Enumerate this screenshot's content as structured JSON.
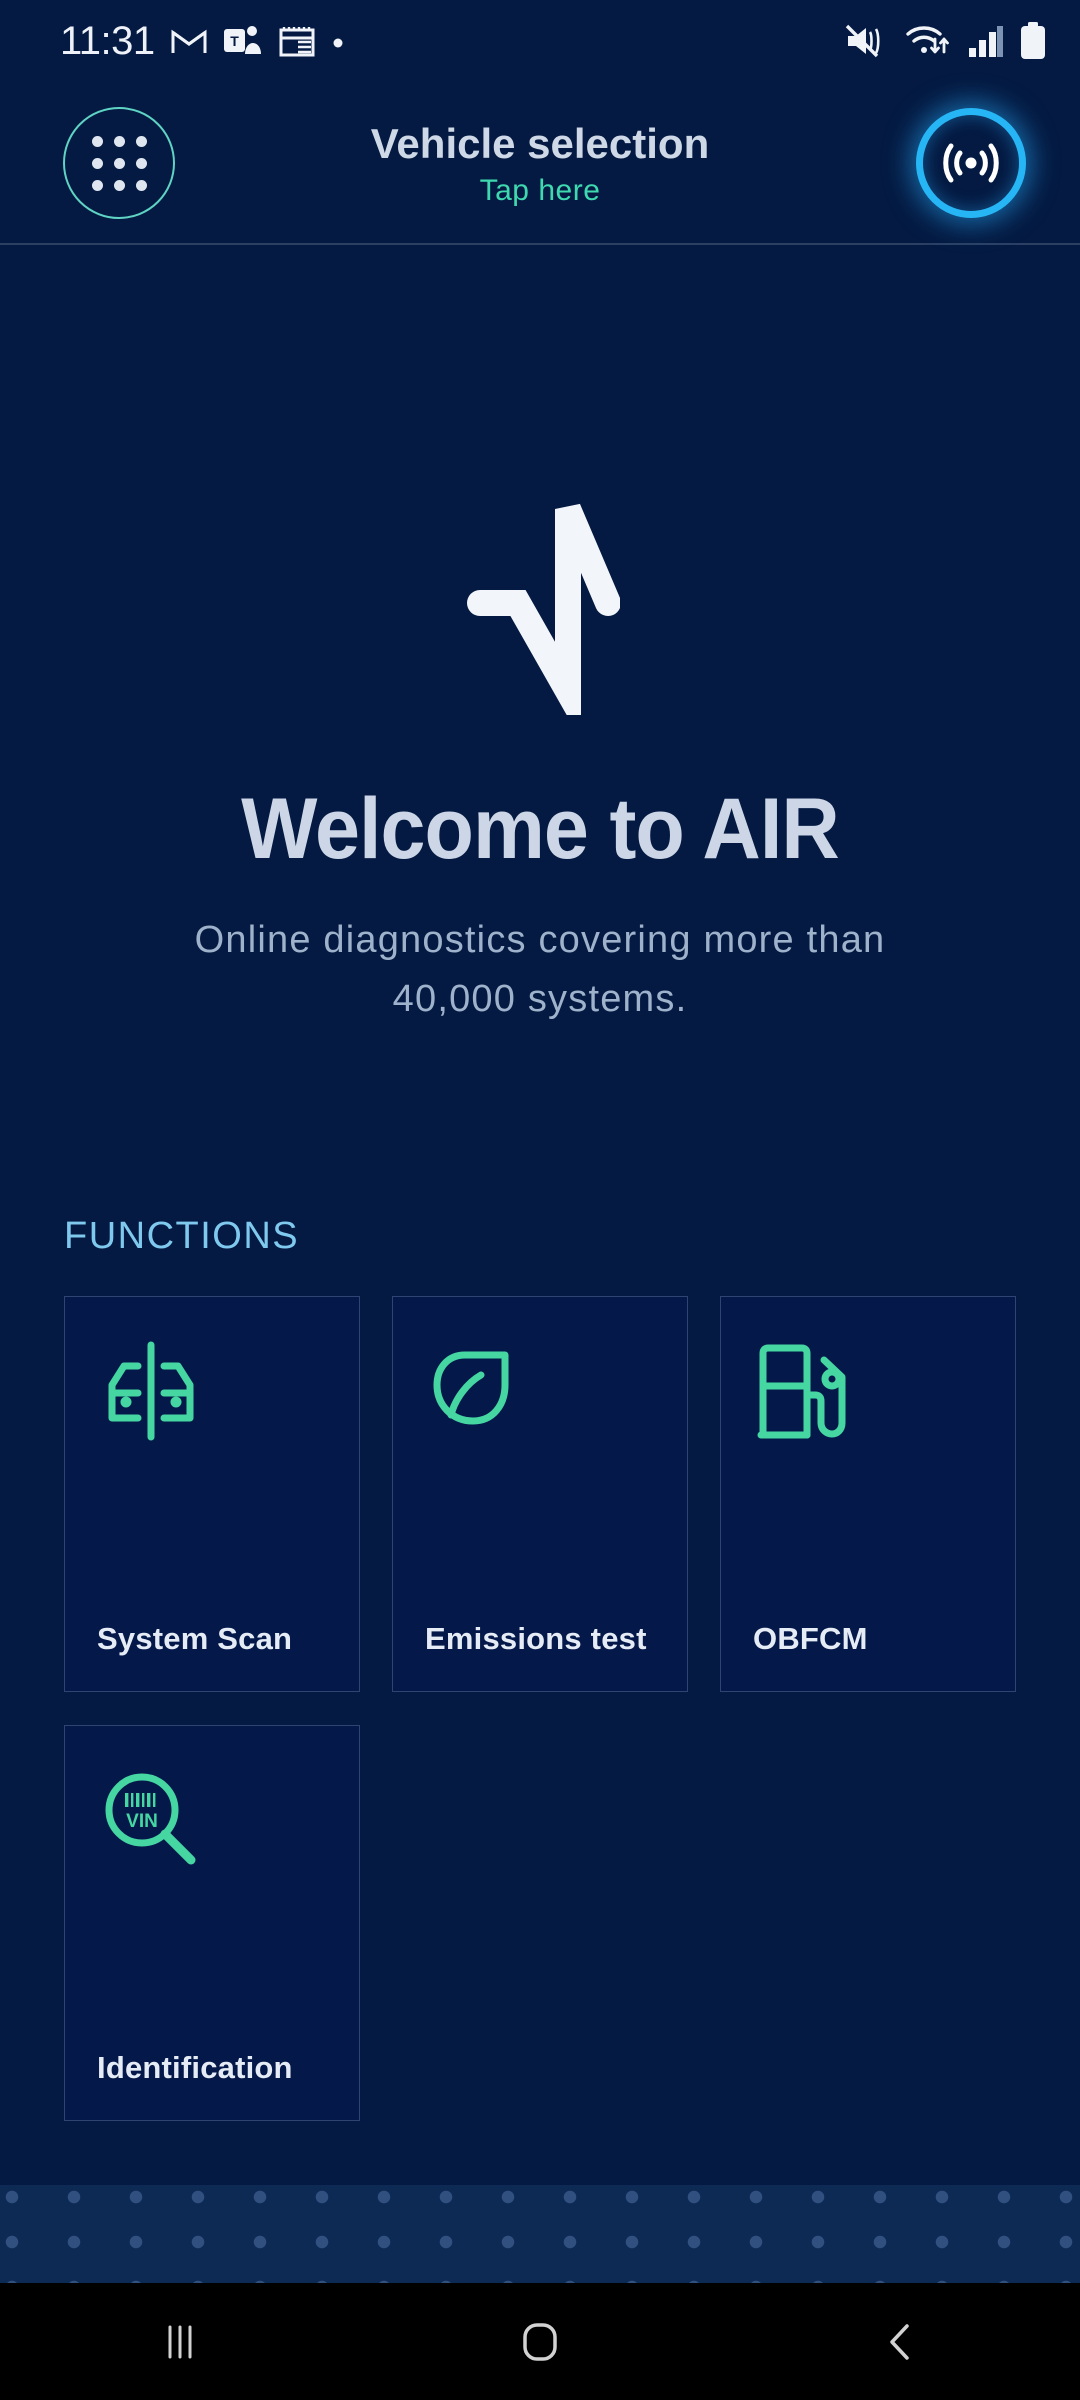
{
  "status_bar": {
    "time": "11:31",
    "left_icons": [
      {
        "name": "gmail-icon",
        "label": "Gmail"
      },
      {
        "name": "teams-icon",
        "label": "Microsoft Teams"
      },
      {
        "name": "calendar-icon",
        "label": "Calendar"
      },
      {
        "name": "notification-dot-icon",
        "label": "More notifications"
      }
    ],
    "right_icons": [
      {
        "name": "mute-vibrate-icon",
        "label": "Sound muted / vibrate"
      },
      {
        "name": "wifi-icon",
        "label": "Wi-Fi connected"
      },
      {
        "name": "cellular-signal-icon",
        "label": "Mobile signal"
      },
      {
        "name": "battery-icon",
        "label": "Battery full"
      }
    ]
  },
  "header": {
    "menu_icon": "grid-menu-icon",
    "title": "Vehicle selection",
    "subtitle": "Tap here",
    "connection_icon": "broadcast-signal-icon",
    "subtitle_color": "#3fd9b0",
    "connection_color": "#27b6f5"
  },
  "hero": {
    "logo_icon": "pulse-waveform-logo",
    "title": "Welcome to AIR",
    "subtitle": "Online diagnostics covering more than 40,000 systems."
  },
  "functions": {
    "heading": "FUNCTIONS",
    "accent_color": "#45d6a2",
    "cards": [
      {
        "label": "System Scan",
        "icon": "car-scan-icon"
      },
      {
        "label": "Emissions test",
        "icon": "leaf-icon"
      },
      {
        "label": "OBFCM",
        "icon": "fuel-pump-icon"
      },
      {
        "label": "Identification",
        "icon": "vin-magnifier-icon"
      }
    ]
  },
  "nav_bar": {
    "buttons": [
      {
        "name": "recents-button",
        "icon": "recents-icon",
        "label": "Recents"
      },
      {
        "name": "home-button",
        "icon": "home-icon",
        "label": "Home"
      },
      {
        "name": "back-button",
        "icon": "back-chevron-icon",
        "label": "Back"
      }
    ]
  },
  "theme": {
    "background": "#041A42",
    "card_background": "#04194a",
    "card_border": "#2f4470"
  }
}
